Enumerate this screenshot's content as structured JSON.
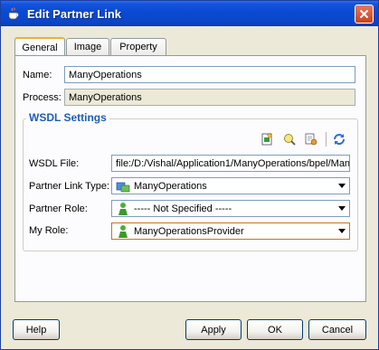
{
  "window": {
    "title": "Edit Partner Link"
  },
  "tabs": [
    {
      "label": "General",
      "active": true
    },
    {
      "label": "Image",
      "active": false
    },
    {
      "label": "Property",
      "active": false
    }
  ],
  "general": {
    "name_label": "Name:",
    "name_value": "ManyOperations",
    "process_label": "Process:",
    "process_value": "ManyOperations"
  },
  "wsdl": {
    "group_title": "WSDL Settings",
    "wsdl_file_label": "WSDL File:",
    "wsdl_file_value": "file:/D:/Vishal/Application1/ManyOperations/bpel/Man",
    "partner_link_type_label": "Partner Link Type:",
    "partner_link_type_value": "ManyOperations",
    "partner_role_label": "Partner Role:",
    "partner_role_value": "----- Not Specified -----",
    "my_role_label": "My Role:",
    "my_role_value": "ManyOperationsProvider",
    "toolbar_icons": [
      "create-wsdl-icon",
      "browse-wsdl-icon",
      "service-explorer-icon",
      "refresh-icon"
    ]
  },
  "buttons": {
    "help": "Help",
    "apply": "Apply",
    "ok": "OK",
    "cancel": "Cancel"
  },
  "colors": {
    "titlebar": "#0a49d2",
    "group_title": "#1d5eb6",
    "focus_border": "#c5761e"
  }
}
